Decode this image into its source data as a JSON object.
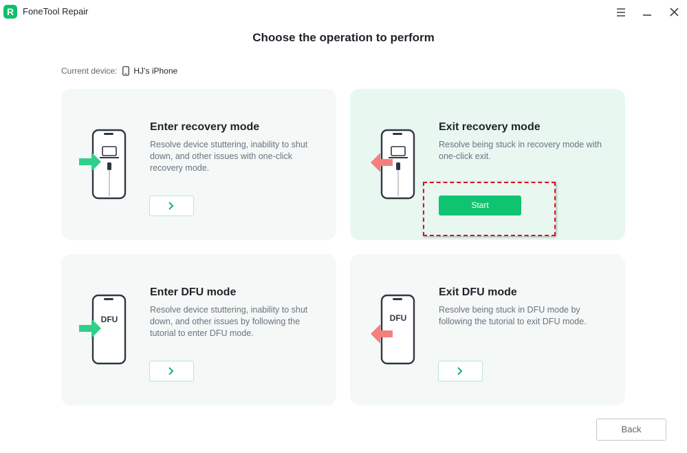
{
  "app": {
    "title": "FoneTool Repair",
    "logo_letter": "R",
    "icons": [
      "menu-icon",
      "minimize-icon",
      "close-icon"
    ]
  },
  "heading": "Choose the operation to perform",
  "device": {
    "label": "Current device:",
    "name": "HJ’s iPhone",
    "icon": "phone-icon"
  },
  "cards": [
    {
      "title": "Enter recovery mode",
      "description": "Resolve device stuttering, inability to shut down, and other issues with one-click recovery mode.",
      "illustration": "phone-laptop-cable-enter",
      "arrow_color": "#2fd08a"
    },
    {
      "title": "Exit recovery mode",
      "description": "Resolve being stuck in recovery mode with one-click exit.",
      "illustration": "phone-laptop-cable-exit",
      "arrow_color": "#f47f7f",
      "button_label": "Start"
    },
    {
      "title": "Enter DFU mode",
      "description": "Resolve device stuttering, inability to shut down, and other issues by following the tutorial to enter DFU mode.",
      "illustration": "phone-dfu-enter",
      "dfu_label": "DFU",
      "arrow_color": "#2fd08a"
    },
    {
      "title": "Exit DFU mode",
      "description": "Resolve being stuck in DFU mode by following the tutorial to exit DFU mode.",
      "illustration": "phone-dfu-exit",
      "dfu_label": "DFU",
      "arrow_color": "#f47f7f"
    }
  ],
  "back_label": "Back",
  "colors": {
    "brand_green": "#0fc471",
    "card_bg": "#f4f8f6",
    "card_highlight_bg": "#e9f7f1",
    "highlight_border": "#d9121b"
  }
}
